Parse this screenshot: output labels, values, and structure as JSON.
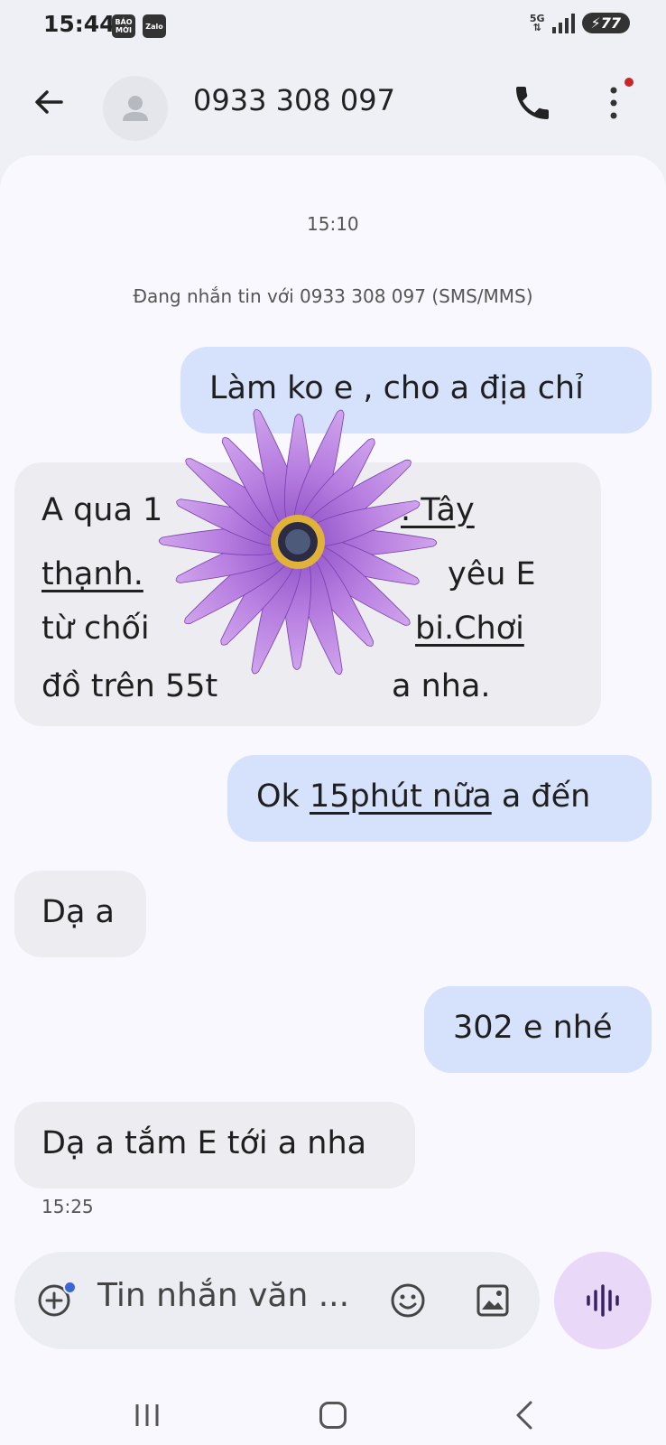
{
  "status_bar": {
    "time": "15:44",
    "app_badges": [
      "BÁO MỚI",
      "Zalo"
    ],
    "network": "5G",
    "battery": "77"
  },
  "header": {
    "title": "0933 308 097",
    "icons": [
      "back-arrow-icon",
      "avatar-icon",
      "phone-icon",
      "more-vert-icon"
    ]
  },
  "conversation": {
    "timestamp_top": "15:10",
    "info_line": "Đang nhắn tin với 0933 308 097 (SMS/MMS)",
    "messages": [
      {
        "direction": "outgoing",
        "text": "Làm ko e , cho a địa chỉ"
      },
      {
        "direction": "incoming",
        "lines": [
          "A qua 1",
          ". Tây",
          "thạnh.",
          "yêu E",
          "từ chối",
          "bi.Chơi",
          "đồ trên 55t",
          "a nha."
        ]
      },
      {
        "direction": "outgoing",
        "text_pre": "Ok ",
        "text_link": "15phút nữa",
        "text_post": " a đến"
      },
      {
        "direction": "incoming",
        "text": "Dạ a"
      },
      {
        "direction": "outgoing",
        "text": "302 e nhé"
      },
      {
        "direction": "incoming",
        "text": "Dạ a tắm E tới a nha"
      }
    ],
    "timestamp_bottom": "15:25"
  },
  "composer": {
    "placeholder": "Tin nhắn văn ...",
    "icons": [
      "add-circle-icon",
      "emoji-icon",
      "gallery-icon",
      "voice-wave-icon"
    ]
  },
  "nav_bar": {
    "icons": [
      "recent-apps-icon",
      "home-icon",
      "back-icon"
    ]
  },
  "colors": {
    "outgoing_bubble": "#d6e1fb",
    "incoming_bubble": "#ececf1",
    "mic_button": "#ead8f8",
    "background": "#f8f8fe"
  }
}
